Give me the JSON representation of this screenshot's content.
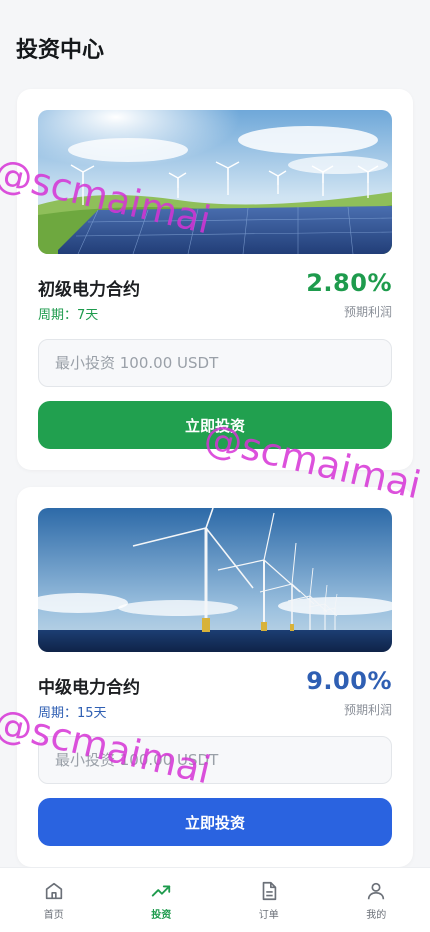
{
  "page": {
    "title": "投资中心"
  },
  "colors": {
    "green": "#21a04f",
    "blue": "#2a63e0",
    "rate_green": "#1e9b4d",
    "rate_blue": "#2f5fb3",
    "watermark": "#d633d6"
  },
  "contracts": [
    {
      "name": "初级电力合约",
      "period": "周期：7天",
      "rate": "2.80%",
      "rate_label": "预期利润",
      "placeholder": "最小投资 100.00 USDT",
      "button": "立即投资",
      "image_icon": "solar-wind-landscape"
    },
    {
      "name": "中级电力合约",
      "period": "周期：15天",
      "rate": "9.00%",
      "rate_label": "预期利润",
      "placeholder": "最小投资 100.00 USDT",
      "button": "立即投资",
      "image_icon": "offshore-wind-farm"
    }
  ],
  "tabbar": {
    "items": [
      {
        "label": "首页",
        "icon": "home-icon"
      },
      {
        "label": "投资",
        "icon": "trending-up-icon",
        "active": true
      },
      {
        "label": "订单",
        "icon": "document-icon"
      },
      {
        "label": "我的",
        "icon": "user-icon"
      }
    ]
  },
  "watermark": {
    "text": "@scmaimai"
  }
}
